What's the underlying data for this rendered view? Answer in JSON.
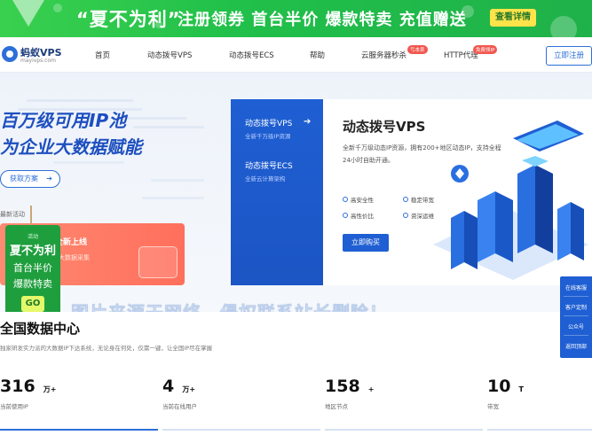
{
  "promo_banner": {
    "quote": "“夏不为利”",
    "slogan": "注册领券  首台半价  爆款特卖  充值赠送",
    "button": "查看详情"
  },
  "nav": {
    "logo_name": "蚂蚁VPS",
    "logo_url": "mayivps.com",
    "items": [
      {
        "label": "首页"
      },
      {
        "label": "动态拨号VPS"
      },
      {
        "label": "动态拨号ECS"
      },
      {
        "label": "帮助"
      },
      {
        "label": "云服务器秒杀",
        "badge": "亏本卖"
      },
      {
        "label": "HTTP代理",
        "badge": "免费领IP"
      }
    ],
    "register": "立即注册"
  },
  "hero": {
    "title_line1": "百万级可用IP池",
    "title_line2": "为企业大数据赋能",
    "cta": "获取方案",
    "recent_label": "最新活动",
    "promo_card": {
      "title": "全新上线",
      "subtitle": "大数据采集"
    },
    "tag": {
      "small": "活动",
      "big": "夏不为利",
      "line1": "首台半价",
      "line2": "爆款特卖",
      "go": "GO"
    }
  },
  "product_panel": {
    "tabs": [
      {
        "title": "动态拨号VPS",
        "subtitle": "全新千万级IP资源"
      },
      {
        "title": "动态拨号ECS",
        "subtitle": "全新云计算架构"
      }
    ],
    "title": "动态拨号VPS",
    "description": "全新千万级动态IP资源，拥有200+地区动态IP，支持全程24小时自助开通。",
    "features": [
      "高安全性",
      "稳定带宽",
      "高性价比",
      "资深运维"
    ],
    "buy_button": "立即购买"
  },
  "watermark": "图片来源于网络，侵权联系站长删除！",
  "side_float": [
    "在线客服",
    "客户定制",
    "公众号",
    "返回顶部"
  ],
  "data_center": {
    "title": "全国数据中心",
    "subtitle": "独家研发实力派的大数据IP下达系统，无论身在何处，仅需一键，让全国IP尽在掌握",
    "stats": [
      {
        "num": "316",
        "unit": "万+",
        "label": "当前使用IP"
      },
      {
        "num": "4",
        "unit": "万+",
        "label": "当前在线用户"
      },
      {
        "num": "158",
        "unit": "+",
        "label": "地区节点"
      },
      {
        "num": "10",
        "unit": "T",
        "label": "带宽"
      }
    ]
  },
  "colors": {
    "brand_blue": "#1f5fd3",
    "promo_green": "#21c04a",
    "promo_yellow": "#ffe34a",
    "promo_red": "#ff6f5c"
  }
}
